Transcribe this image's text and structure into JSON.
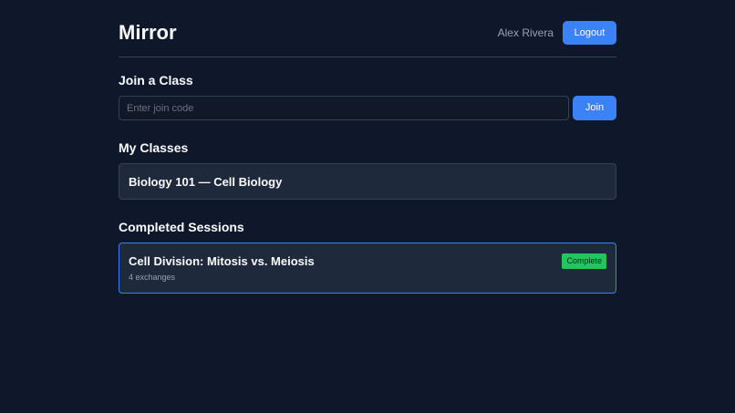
{
  "app": {
    "title": "Mirror"
  },
  "header": {
    "user_name": "Alex Rivera",
    "logout_label": "Logout"
  },
  "join": {
    "section_title": "Join a Class",
    "placeholder": "Enter join code",
    "value": "",
    "button_label": "Join"
  },
  "classes": {
    "section_title": "My Classes",
    "items": [
      {
        "name": "Biology 101 — Cell Biology"
      }
    ]
  },
  "sessions": {
    "section_title": "Completed Sessions",
    "items": [
      {
        "title": "Cell Division: Mitosis vs. Meiosis",
        "meta": "4 exchanges",
        "status": "Complete"
      }
    ]
  },
  "colors": {
    "background": "#0f172a",
    "card": "#1e293b",
    "accent": "#3b82f6",
    "success": "#22c55e"
  }
}
